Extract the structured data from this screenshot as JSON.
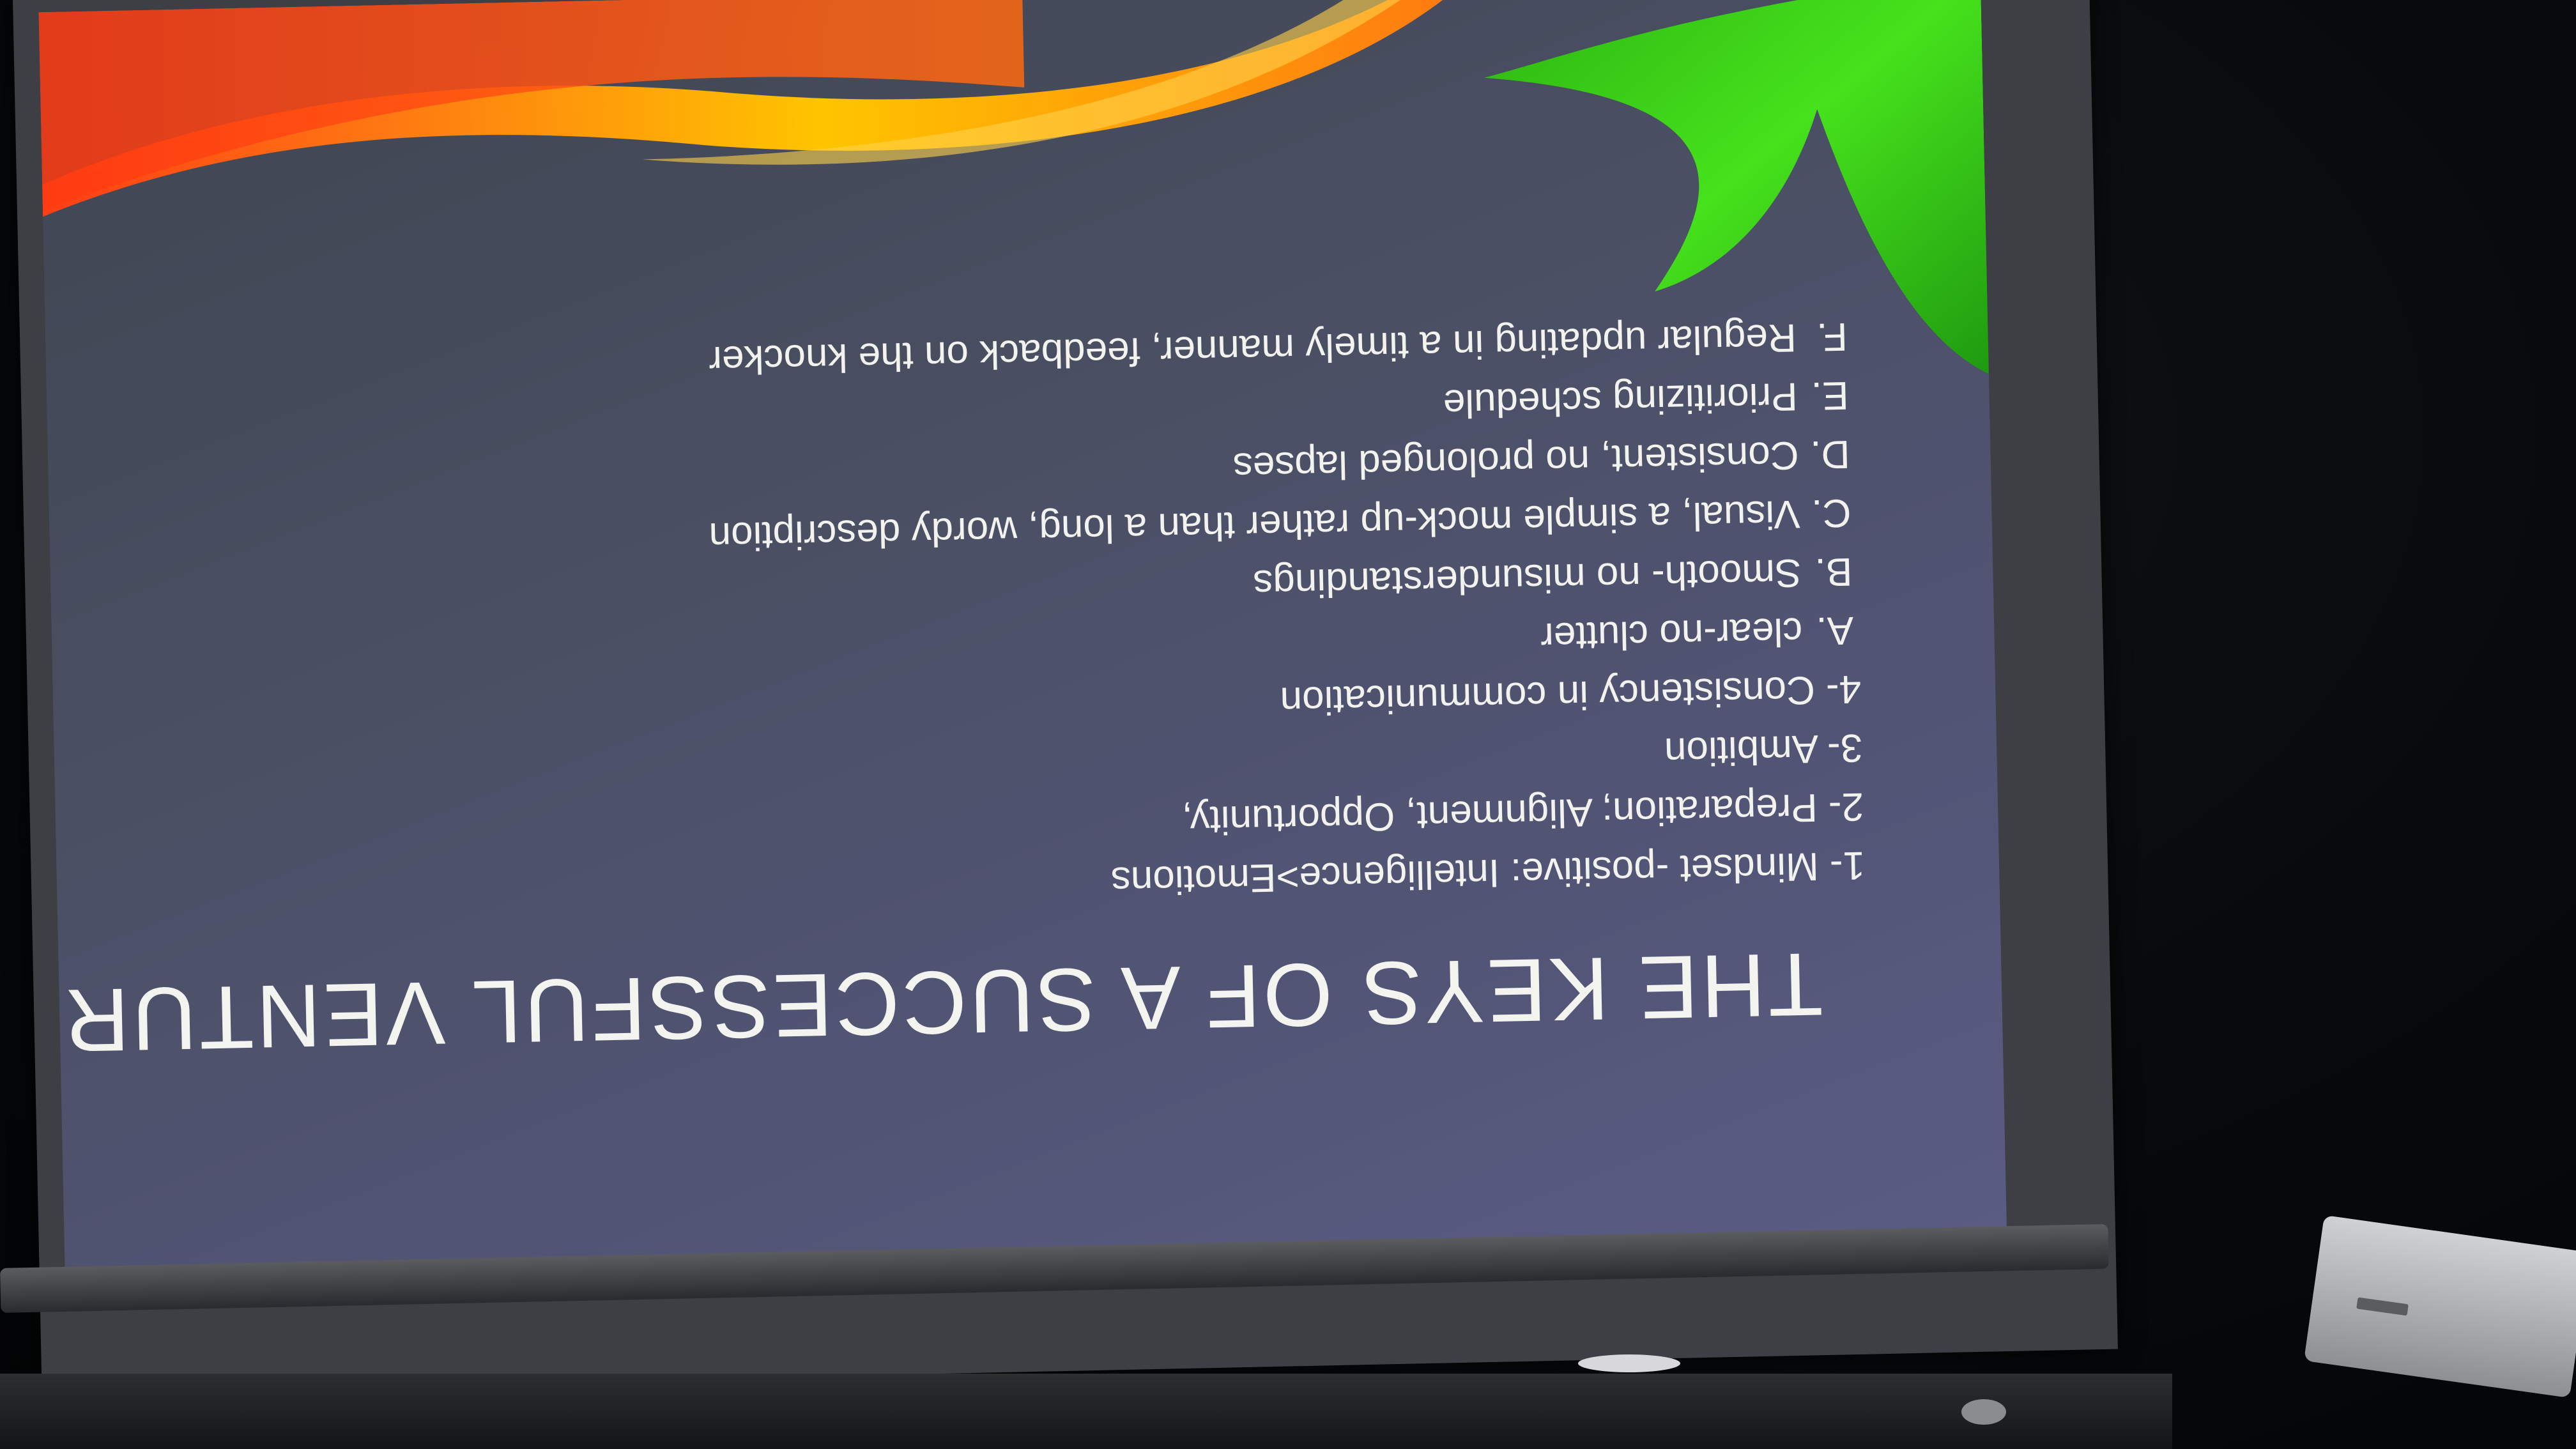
{
  "slide": {
    "title": "THE KEYS OF A SUCCESSFUL VENTURE",
    "points": [
      "1- Mindset -positive: Intelligence>Emotions",
      "2- Preparation; Alignment, Opportunity,",
      "3- Ambition",
      "4- Consistency in communication"
    ],
    "subpoints": [
      {
        "letter": "A.",
        "text": "clear-no clutter"
      },
      {
        "letter": "B.",
        "text": "Smooth- no misunderstandings"
      },
      {
        "letter": "C.",
        "text": "Visual, a simple mock-up rather than a long, wordy description"
      },
      {
        "letter": "D.",
        "text": "Consistent, no prolonged lapses"
      },
      {
        "letter": "E.",
        "text": "Prioritizing schedule"
      },
      {
        "letter": "F.",
        "text": "Regular updating in a timely manner, feedback on the knocker"
      }
    ]
  },
  "colors": {
    "screen": "#4a4f63",
    "ribbon_green": "#3fd21a",
    "ribbon_orange": "#ff5a10",
    "ribbon_yellow": "#ffb000",
    "text": "#f2f2ee"
  }
}
